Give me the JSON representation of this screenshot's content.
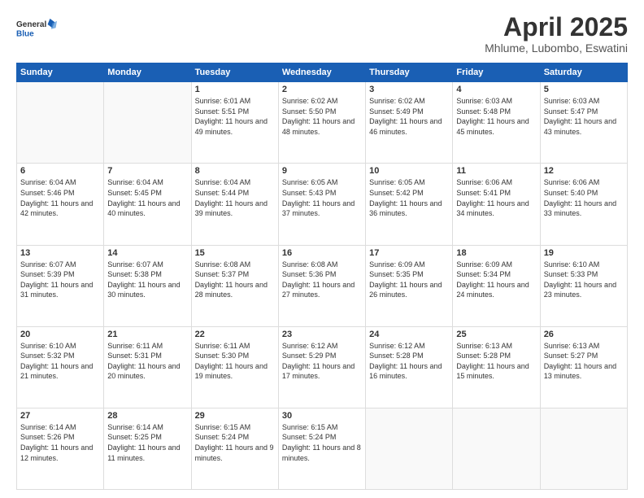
{
  "header": {
    "logo_line1": "General",
    "logo_line2": "Blue",
    "month_title": "April 2025",
    "location": "Mhlume, Lubombo, Eswatini"
  },
  "weekdays": [
    "Sunday",
    "Monday",
    "Tuesday",
    "Wednesday",
    "Thursday",
    "Friday",
    "Saturday"
  ],
  "weeks": [
    [
      {
        "day": "",
        "info": ""
      },
      {
        "day": "",
        "info": ""
      },
      {
        "day": "1",
        "info": "Sunrise: 6:01 AM\nSunset: 5:51 PM\nDaylight: 11 hours and 49 minutes."
      },
      {
        "day": "2",
        "info": "Sunrise: 6:02 AM\nSunset: 5:50 PM\nDaylight: 11 hours and 48 minutes."
      },
      {
        "day": "3",
        "info": "Sunrise: 6:02 AM\nSunset: 5:49 PM\nDaylight: 11 hours and 46 minutes."
      },
      {
        "day": "4",
        "info": "Sunrise: 6:03 AM\nSunset: 5:48 PM\nDaylight: 11 hours and 45 minutes."
      },
      {
        "day": "5",
        "info": "Sunrise: 6:03 AM\nSunset: 5:47 PM\nDaylight: 11 hours and 43 minutes."
      }
    ],
    [
      {
        "day": "6",
        "info": "Sunrise: 6:04 AM\nSunset: 5:46 PM\nDaylight: 11 hours and 42 minutes."
      },
      {
        "day": "7",
        "info": "Sunrise: 6:04 AM\nSunset: 5:45 PM\nDaylight: 11 hours and 40 minutes."
      },
      {
        "day": "8",
        "info": "Sunrise: 6:04 AM\nSunset: 5:44 PM\nDaylight: 11 hours and 39 minutes."
      },
      {
        "day": "9",
        "info": "Sunrise: 6:05 AM\nSunset: 5:43 PM\nDaylight: 11 hours and 37 minutes."
      },
      {
        "day": "10",
        "info": "Sunrise: 6:05 AM\nSunset: 5:42 PM\nDaylight: 11 hours and 36 minutes."
      },
      {
        "day": "11",
        "info": "Sunrise: 6:06 AM\nSunset: 5:41 PM\nDaylight: 11 hours and 34 minutes."
      },
      {
        "day": "12",
        "info": "Sunrise: 6:06 AM\nSunset: 5:40 PM\nDaylight: 11 hours and 33 minutes."
      }
    ],
    [
      {
        "day": "13",
        "info": "Sunrise: 6:07 AM\nSunset: 5:39 PM\nDaylight: 11 hours and 31 minutes."
      },
      {
        "day": "14",
        "info": "Sunrise: 6:07 AM\nSunset: 5:38 PM\nDaylight: 11 hours and 30 minutes."
      },
      {
        "day": "15",
        "info": "Sunrise: 6:08 AM\nSunset: 5:37 PM\nDaylight: 11 hours and 28 minutes."
      },
      {
        "day": "16",
        "info": "Sunrise: 6:08 AM\nSunset: 5:36 PM\nDaylight: 11 hours and 27 minutes."
      },
      {
        "day": "17",
        "info": "Sunrise: 6:09 AM\nSunset: 5:35 PM\nDaylight: 11 hours and 26 minutes."
      },
      {
        "day": "18",
        "info": "Sunrise: 6:09 AM\nSunset: 5:34 PM\nDaylight: 11 hours and 24 minutes."
      },
      {
        "day": "19",
        "info": "Sunrise: 6:10 AM\nSunset: 5:33 PM\nDaylight: 11 hours and 23 minutes."
      }
    ],
    [
      {
        "day": "20",
        "info": "Sunrise: 6:10 AM\nSunset: 5:32 PM\nDaylight: 11 hours and 21 minutes."
      },
      {
        "day": "21",
        "info": "Sunrise: 6:11 AM\nSunset: 5:31 PM\nDaylight: 11 hours and 20 minutes."
      },
      {
        "day": "22",
        "info": "Sunrise: 6:11 AM\nSunset: 5:30 PM\nDaylight: 11 hours and 19 minutes."
      },
      {
        "day": "23",
        "info": "Sunrise: 6:12 AM\nSunset: 5:29 PM\nDaylight: 11 hours and 17 minutes."
      },
      {
        "day": "24",
        "info": "Sunrise: 6:12 AM\nSunset: 5:28 PM\nDaylight: 11 hours and 16 minutes."
      },
      {
        "day": "25",
        "info": "Sunrise: 6:13 AM\nSunset: 5:28 PM\nDaylight: 11 hours and 15 minutes."
      },
      {
        "day": "26",
        "info": "Sunrise: 6:13 AM\nSunset: 5:27 PM\nDaylight: 11 hours and 13 minutes."
      }
    ],
    [
      {
        "day": "27",
        "info": "Sunrise: 6:14 AM\nSunset: 5:26 PM\nDaylight: 11 hours and 12 minutes."
      },
      {
        "day": "28",
        "info": "Sunrise: 6:14 AM\nSunset: 5:25 PM\nDaylight: 11 hours and 11 minutes."
      },
      {
        "day": "29",
        "info": "Sunrise: 6:15 AM\nSunset: 5:24 PM\nDaylight: 11 hours and 9 minutes."
      },
      {
        "day": "30",
        "info": "Sunrise: 6:15 AM\nSunset: 5:24 PM\nDaylight: 11 hours and 8 minutes."
      },
      {
        "day": "",
        "info": ""
      },
      {
        "day": "",
        "info": ""
      },
      {
        "day": "",
        "info": ""
      }
    ]
  ]
}
